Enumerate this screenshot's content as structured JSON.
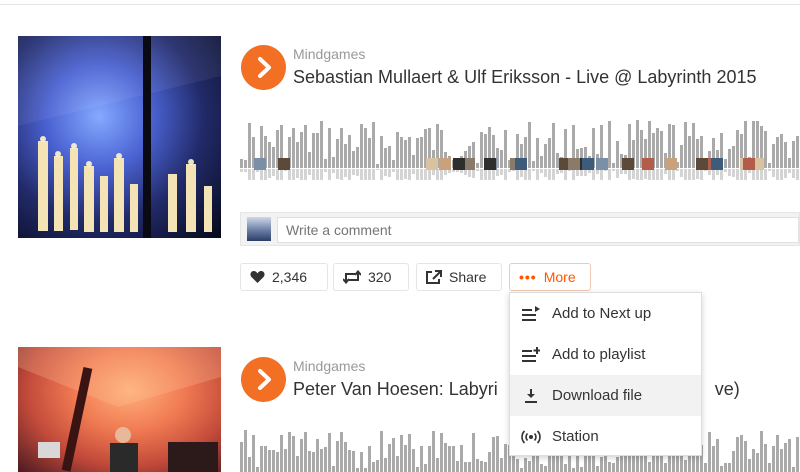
{
  "tracks": [
    {
      "user": "Mindgames",
      "title": "Sebastian Mullaert & Ulf Eriksson - Live @ Labyrinth 2015"
    },
    {
      "user": "Mindgames",
      "title": "Peter Van Hoesen: Labyri",
      "title_tail": "ve)"
    }
  ],
  "comment": {
    "placeholder": "Write a comment"
  },
  "actions": {
    "like_count": "2,346",
    "repost_count": "320",
    "share_label": "Share",
    "more_label": "More"
  },
  "more_menu": {
    "items": [
      {
        "label": "Add to Next up",
        "icon": "next-up-icon"
      },
      {
        "label": "Add to playlist",
        "icon": "add-playlist-icon"
      },
      {
        "label": "Download file",
        "icon": "download-icon"
      },
      {
        "label": "Station",
        "icon": "station-icon"
      }
    ]
  },
  "colors": {
    "accent": "#f26f23",
    "waveform": "#aaaaaa"
  }
}
